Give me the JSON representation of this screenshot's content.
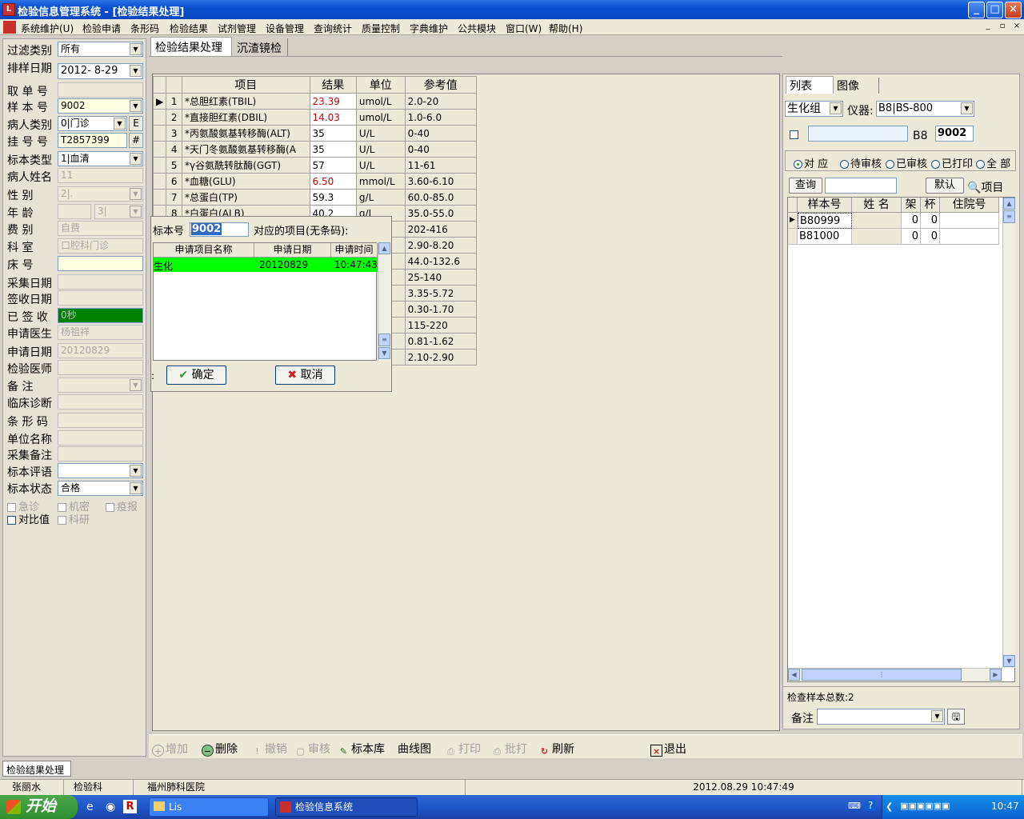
{
  "window": {
    "title": "检验信息管理系统 - [检验结果处理]",
    "minimize": "_",
    "maximize": "□",
    "close": "×"
  },
  "menu": [
    "系统维护(U)",
    "检验申请",
    "条形码",
    "检验结果",
    "试剂管理",
    "设备管理",
    "查询统计",
    "质量控制",
    "字典维护",
    "公共模块",
    "窗口(W)",
    "帮助(H)"
  ],
  "left": {
    "filter_label": "过滤类别",
    "filter_value": "所有",
    "date_label": "排样日期",
    "date_value": "2012- 8-29",
    "fetch_label": "取 单 号",
    "fetch_value": "",
    "sample_label": "样 本 号",
    "sample_value": "9002",
    "ptype_label": "病人类别",
    "ptype_value": "0|门诊",
    "ptype_btn": "E",
    "reg_label": "挂 号 号",
    "reg_value": "T2857399",
    "reg_btn": "#",
    "stype_label": "标本类型",
    "stype_value": "1|血清",
    "name_label": "病人姓名",
    "name_value": "11",
    "sex_label": "性    别",
    "sex_value": "2|.",
    "age_label": "年    龄",
    "age_value": "",
    "age_unit": "3|",
    "fee_label": "费    别",
    "fee_value": "自费",
    "dept_label": "科    室",
    "dept_value": "口腔科门诊",
    "bed_label": "床    号",
    "bed_value": "",
    "collect_label": "采集日期",
    "collect_value": "",
    "receive_label": "签收日期",
    "receive_value": "",
    "signed_label": "已 签 收",
    "signed_value": "0秒",
    "doctor_label": "申请医生",
    "doctor_value": "杨祖祥",
    "apply_label": "申请日期",
    "apply_value": "20120829",
    "checker_label": "检验医师",
    "checker_value": "",
    "note_label": "备    注",
    "note_value": "",
    "diag_label": "临床诊断",
    "diag_value": "",
    "barcode_label": "条 形 码",
    "barcode_value": "",
    "unit_label": "单位名称",
    "unit_value": "",
    "collnote_label": "采集备注",
    "collnote_value": "",
    "eval_label": "标本评语",
    "eval_value": "",
    "status_label": "标本状态",
    "status_value": "合格",
    "checks": [
      "急诊",
      "机密",
      "疫报",
      "对比值",
      "科研"
    ]
  },
  "tabs": [
    "检验结果处理",
    "沉渣镜检"
  ],
  "grid": {
    "headers": [
      "项目",
      "结果",
      "单位",
      "参考值"
    ],
    "rows": [
      {
        "no": "1",
        "name": "*总胆红素(TBIL)",
        "result": "23.39",
        "unit": "umol/L",
        "ref": "2.0-20",
        "abnormal": true
      },
      {
        "no": "2",
        "name": "*直接胆红素(DBIL)",
        "result": "14.03",
        "unit": "umol/L",
        "ref": "1.0-6.0",
        "abnormal": true
      },
      {
        "no": "3",
        "name": "*丙氨酸氨基转移酶(ALT)",
        "result": "35",
        "unit": "U/L",
        "ref": "0-40",
        "abnormal": false
      },
      {
        "no": "4",
        "name": "*天门冬氨酸氨基转移酶(A",
        "result": "35",
        "unit": "U/L",
        "ref": "0-40",
        "abnormal": false
      },
      {
        "no": "5",
        "name": "*γ谷氨酰转肽酶(GGT)",
        "result": "57",
        "unit": "U/L",
        "ref": "11-61",
        "abnormal": false
      },
      {
        "no": "6",
        "name": "*血糖(GLU)",
        "result": "6.50",
        "unit": "mmol/L",
        "ref": "3.60-6.10",
        "abnormal": true
      },
      {
        "no": "7",
        "name": "*总蛋白(TP)",
        "result": "59.3",
        "unit": "g/L",
        "ref": "60.0-85.0",
        "abnormal": false
      },
      {
        "no": "8",
        "name": "*白蛋白(ALB)",
        "result": "40.2",
        "unit": "g/L",
        "ref": "35.0-55.0",
        "abnormal": false
      },
      {
        "no": "",
        "name": "",
        "result": "",
        "unit": "",
        "ref": "202-416",
        "abnormal": false
      },
      {
        "no": "",
        "name": "",
        "result": "",
        "unit": "",
        "ref": "2.90-8.20",
        "abnormal": false
      },
      {
        "no": "",
        "name": "",
        "result": "",
        "unit": "",
        "ref": "44.0-132.6",
        "abnormal": false
      },
      {
        "no": "",
        "name": "",
        "result": "",
        "unit": "",
        "ref": "25-140",
        "abnormal": false
      },
      {
        "no": "",
        "name": "",
        "result": "",
        "unit": "",
        "ref": "3.35-5.72",
        "abnormal": false
      },
      {
        "no": "",
        "name": "",
        "result": "",
        "unit": "",
        "ref": "0.30-1.70",
        "abnormal": false
      },
      {
        "no": "",
        "name": "",
        "result": "",
        "unit": "",
        "ref": "115-220",
        "abnormal": false
      },
      {
        "no": "",
        "name": "",
        "result": "",
        "unit": "",
        "ref": "0.81-1.62",
        "abnormal": false
      },
      {
        "no": "",
        "name": "",
        "result": "",
        "unit": "",
        "ref": "2.10-2.90",
        "abnormal": false
      }
    ]
  },
  "popup": {
    "label": "标本号",
    "value": "9002",
    "suffix": "对应的项目(无条码):",
    "headers": [
      "申请项目名称",
      "申请日期",
      "申请时间"
    ],
    "row": {
      "name": "生化",
      "date": "20120829",
      "time": "10:47:43"
    },
    "ok": "确定",
    "cancel": "取消",
    "colon": ":"
  },
  "right": {
    "tabs": [
      "列表",
      "图像"
    ],
    "group": "生化组",
    "instrument_label": "仪器:",
    "instrument": "B8|BS-800",
    "b8": "B8",
    "sample": "9002",
    "radios": [
      "对 应",
      "待审核",
      "已审核",
      "已打印",
      "全 部"
    ],
    "query": "查询",
    "default": "默认",
    "items": "项目",
    "headers": [
      "样本号",
      "姓 名",
      "架",
      "杯",
      "住院号"
    ],
    "rows": [
      {
        "id": "B80999",
        "name": "",
        "rack": "0",
        "cup": "0",
        "inpatient": ""
      },
      {
        "id": "B81000",
        "name": "",
        "rack": "0",
        "cup": "0",
        "inpatient": ""
      }
    ],
    "total": "检查样本总数:2",
    "note_label": "备注"
  },
  "toolbar": [
    "增加",
    "删除",
    "撤销",
    "审核",
    "标本库",
    "曲线图",
    "打印",
    "批打",
    "刷新",
    "退出"
  ],
  "formtab": "检验结果处理",
  "status": {
    "user": "张丽水",
    "dept": "检验科",
    "hospital": "福州肺科医院",
    "datetime": "2012.08.29 10:47:49"
  },
  "taskbar": {
    "start": "开始",
    "tasks": [
      "Lis",
      "检验信息系统"
    ],
    "clock": "10:47"
  }
}
